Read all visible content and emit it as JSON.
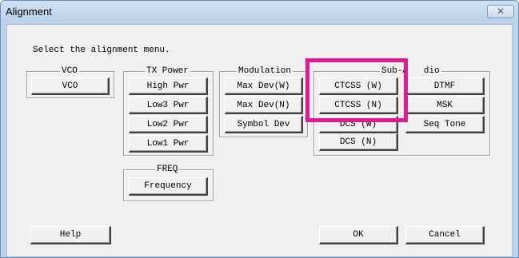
{
  "window": {
    "title": "Alignment",
    "close_icon": "close-icon",
    "close_glyph": "✕"
  },
  "prompt": "Select the alignment menu.",
  "groups": {
    "vco": {
      "label": "VCO",
      "buttons": [
        "VCO"
      ]
    },
    "tx_power": {
      "label": "TX Power",
      "buttons": [
        "High Pwr",
        "Low3 Pwr",
        "Low2 Pwr",
        "Low1 Pwr"
      ]
    },
    "modulation": {
      "label": "Modulation",
      "buttons": [
        "Max Dev(W)",
        "Max Dev(N)",
        "Symbol Dev"
      ]
    },
    "sub_audio": {
      "label": "Sub-Audio",
      "label_visible": "Sub-A   dio",
      "buttons": [
        "CTCSS (W)",
        "CTCSS (N)",
        "DCS (W)",
        "DCS (N)",
        "DTMF",
        "MSK",
        "Seq Tone"
      ]
    },
    "freq": {
      "label": "FREQ",
      "buttons": [
        "Frequency"
      ]
    }
  },
  "footer": {
    "help": "Help",
    "ok": "OK",
    "cancel": "Cancel"
  },
  "colors": {
    "highlight": "#e01a8f",
    "title_bar": "#c4d8ee",
    "dialog_bg": "#f0f0f0"
  }
}
